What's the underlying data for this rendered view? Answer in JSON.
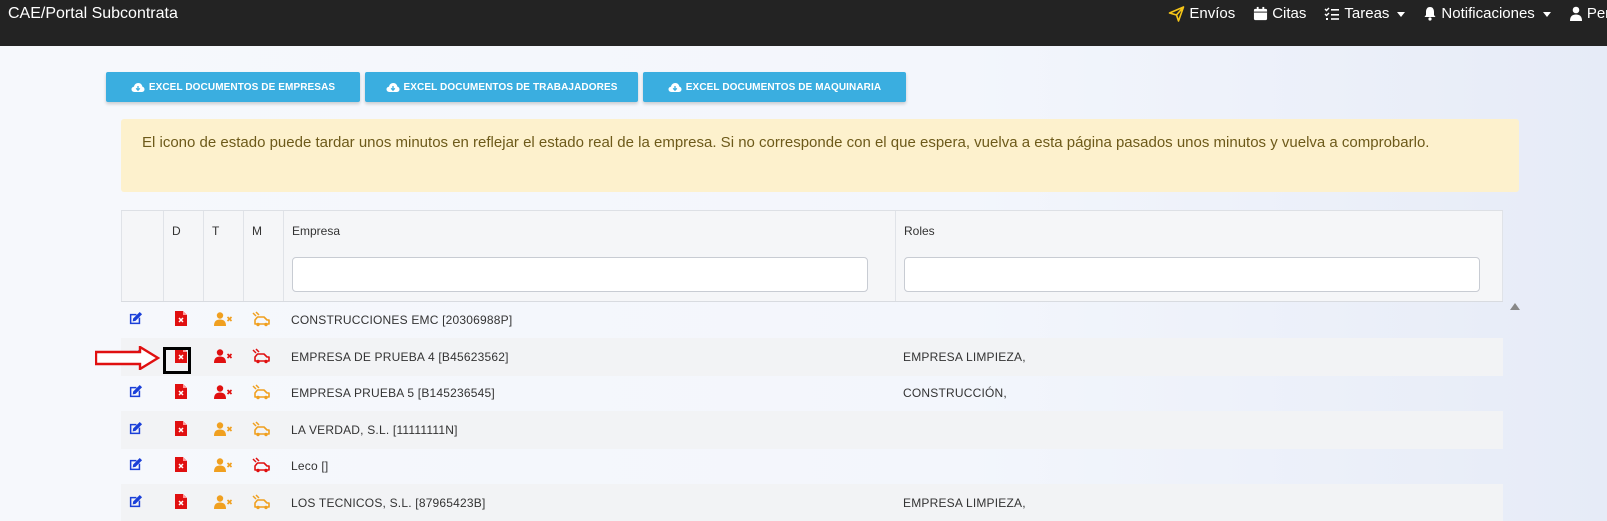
{
  "app": {
    "title": "CAE/Portal Subcontrata"
  },
  "nav": [
    {
      "label": "Envíos",
      "icon": "paper-plane-icon",
      "caret": false
    },
    {
      "label": "Citas",
      "icon": "calendar-icon",
      "caret": false
    },
    {
      "label": "Tareas",
      "icon": "task-list-icon",
      "caret": true
    },
    {
      "label": "Notificaciones",
      "icon": "bell-icon",
      "caret": true
    },
    {
      "label": "Perfil",
      "icon": "user-icon",
      "caret": false
    }
  ],
  "export_buttons": [
    {
      "label": "EXCEL DOCUMENTOS DE EMPRESAS",
      "icon": "cloud-download-icon"
    },
    {
      "label": "EXCEL DOCUMENTOS DE TRABAJADORES",
      "icon": "cloud-download-icon"
    },
    {
      "label": "EXCEL DOCUMENTOS DE MAQUINARIA",
      "icon": "cloud-download-icon"
    }
  ],
  "alert": {
    "text": "El icono de estado puede tardar unos minutos en reflejar el estado real de la empresa. Si no corresponde con el que espera, vuelva a esta página pasados unos minutos y vuelva a comprobarlo."
  },
  "table": {
    "columns": [
      "",
      "D",
      "T",
      "M",
      "Empresa",
      "Roles"
    ],
    "filters": {
      "empresa": "",
      "roles": ""
    },
    "rows": [
      {
        "empresa": "CONSTRUCCIONES EMC [20306988P]",
        "roles": "",
        "t_color": "orange",
        "m_color": "orange"
      },
      {
        "empresa": "EMPRESA DE PRUEBA 4 [B45623562]",
        "roles": "EMPRESA LIMPIEZA,",
        "t_color": "red",
        "m_color": "red"
      },
      {
        "empresa": "EMPRESA PRUEBA 5 [B145236545]",
        "roles": "CONSTRUCCIÓN,",
        "t_color": "red",
        "m_color": "orange"
      },
      {
        "empresa": "LA VERDAD, S.L. [11111111N]",
        "roles": "",
        "t_color": "orange",
        "m_color": "orange"
      },
      {
        "empresa": "Leco []",
        "roles": "",
        "t_color": "orange",
        "m_color": "red"
      },
      {
        "empresa": "LOS TECNICOS, S.L. [87965423B]",
        "roles": "EMPRESA LIMPIEZA,",
        "t_color": "orange",
        "m_color": "orange"
      }
    ]
  },
  "colors": {
    "red": "#e01010",
    "orange": "#f0a020",
    "edit": "#1a3fd8",
    "button": "#3aaee0"
  }
}
